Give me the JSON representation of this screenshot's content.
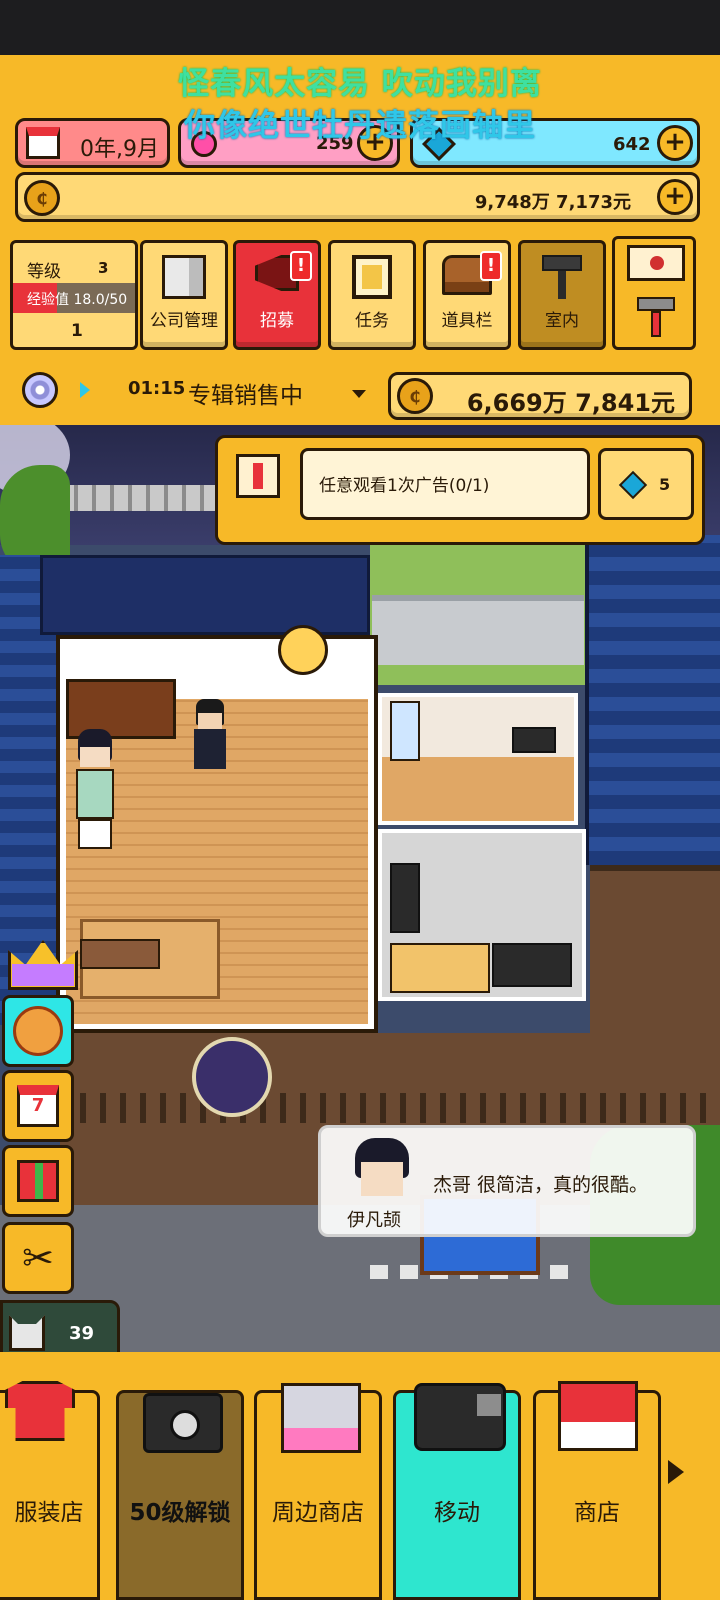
{
  "lyrics": {
    "line1": "怪春风太容易 吹动我别离",
    "line2": "你像绝世牡丹遗落画轴里"
  },
  "top_stats": {
    "date": "0年,9月",
    "gems_pink": "259",
    "diamonds": "642",
    "money": "9,748万 7,173元"
  },
  "level_panel": {
    "level_label": "等级",
    "level_value": "3",
    "exp_label": "经验值 18.0/50",
    "exp_progress": 0.36,
    "count": "1"
  },
  "menu": {
    "company": "公司管理",
    "recruit": "招募",
    "task": "任务",
    "inventory": "道具栏",
    "interior": "室内"
  },
  "album": {
    "timer": "01:15",
    "status": "专辑销售中",
    "earnings": "6,669万 7,841元"
  },
  "quest": {
    "text": "任意观看1次广告(0/1)",
    "reward": "5"
  },
  "dialog": {
    "speaker": "伊凡颉",
    "text": "杰哥 很简洁，真的很酷。"
  },
  "side": {
    "cat_count": "39"
  },
  "bottom": {
    "clothing": "服装店",
    "locked": "50级解锁",
    "merch": "周边商店",
    "move": "移动",
    "shop": "商店"
  },
  "colors": {
    "accent": "#f7b928",
    "red": "#e8323a",
    "teal": "#2ee6cf",
    "pink": "#ff9fc4",
    "cyan": "#7fe8ff"
  }
}
